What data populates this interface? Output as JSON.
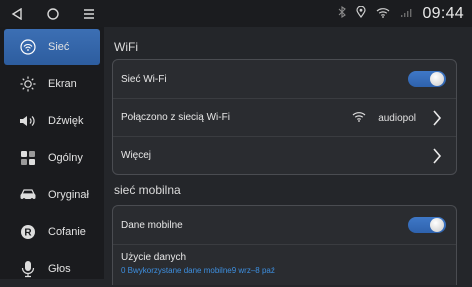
{
  "status": {
    "time": "09:44"
  },
  "sidebar": {
    "items": [
      {
        "label": "Sieć",
        "icon": "wifi-icon"
      },
      {
        "label": "Ekran",
        "icon": "brightness-icon"
      },
      {
        "label": "Dźwięk",
        "icon": "speaker-icon"
      },
      {
        "label": "Ogólny",
        "icon": "grid-icon"
      },
      {
        "label": "Oryginał",
        "icon": "car-icon"
      },
      {
        "label": "Cofanie",
        "icon": "reverse-icon"
      },
      {
        "label": "Głos",
        "icon": "microphone-icon"
      }
    ]
  },
  "wifi": {
    "title": "WiFi",
    "wifi_label": "Sieć Wi-Fi",
    "wifi_enabled": true,
    "connected_label": "Połączono z siecią Wi-Fi",
    "connected_network": "audiopol",
    "more_label": "Więcej"
  },
  "mobile": {
    "title": "sieć mobilna",
    "data_label": "Dane mobilne",
    "data_enabled": true,
    "usage_label": "Użycie danych",
    "usage_detail": "0 Bwykorzystane dane mobilne9 wrz–8 paź"
  },
  "colors": {
    "accent": "#3a70bd",
    "background": "#24262a",
    "sidebar": "#1a1b1e"
  }
}
